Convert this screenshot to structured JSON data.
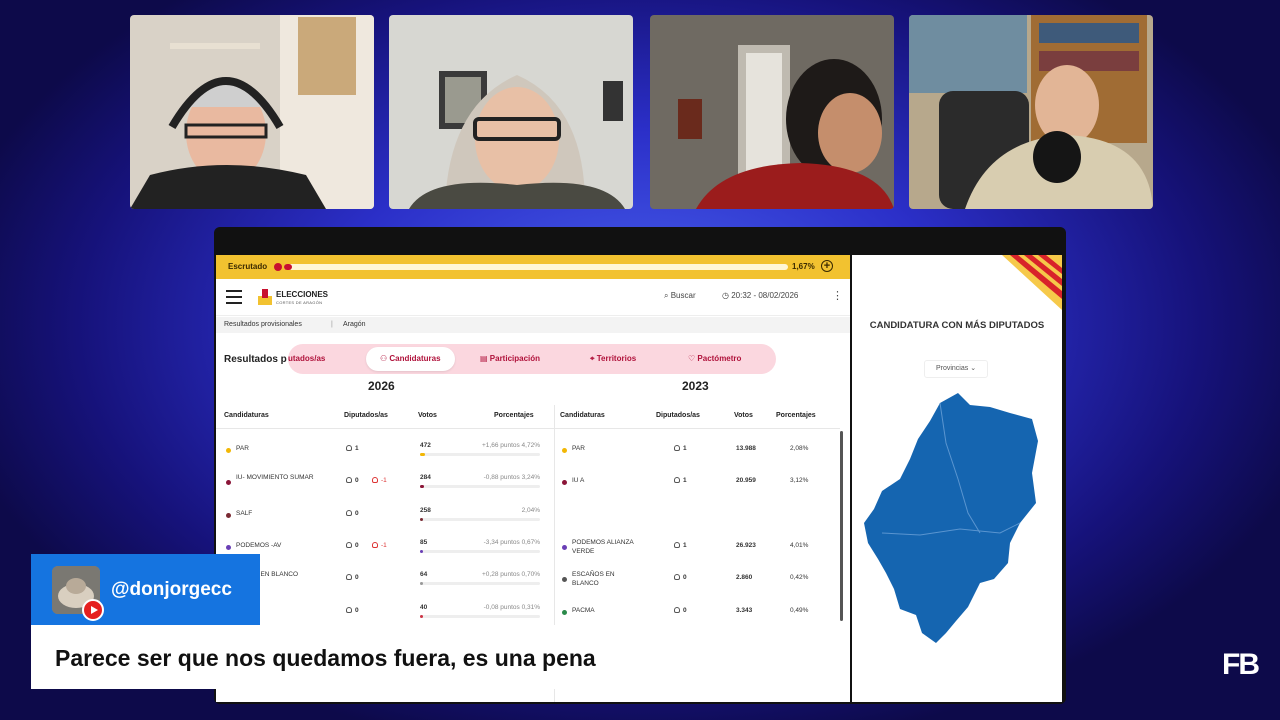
{
  "app": {
    "escrutado_label": "Escrutado",
    "escrutado_pct": "1,67%",
    "escrutado_fraction": 0.0167,
    "logo_title": "ELECCIONES",
    "logo_subtitle": "CORTES DE ARAGÓN",
    "search_label": "Buscar",
    "datetime": "20:32 - 08/02/2026",
    "breadcrumb": [
      "Resultados provisionales",
      "Aragón"
    ],
    "section_title": "Resultados p",
    "tabs": [
      "utados/as",
      "Candidaturas",
      "Participación",
      "Territorios",
      "Pactómetro"
    ],
    "years": [
      "2026",
      "2023"
    ],
    "columns": [
      "Candidaturas",
      "Diputados/as",
      "Votos",
      "Porcentajes"
    ],
    "rows_2026": [
      {
        "name": "PAR",
        "seats": "1",
        "delta": "",
        "votes": "472",
        "change": "+1,66 puntos 4,72%",
        "color": "#f2b705",
        "fill": 0.04
      },
      {
        "name": "IU- MOVIMIENTO SUMAR",
        "seats": "0",
        "delta": "-1",
        "votes": "284",
        "change": "-0,88 puntos 3,24%",
        "color": "#8b1538",
        "fill": 0.03
      },
      {
        "name": "SALF",
        "seats": "0",
        "delta": "",
        "votes": "258",
        "change": "2,04%",
        "color": "#7a2a33",
        "fill": 0.025
      },
      {
        "name": "PODEMOS -AV",
        "seats": "0",
        "delta": "-1",
        "votes": "85",
        "change": "-3,34 puntos 0,67%",
        "color": "#6a3fb5",
        "fill": 0.01
      },
      {
        "name": "VOTOS EN BLANCO",
        "seats": "0",
        "delta": "",
        "votes": "64",
        "change": "+0,28 puntos 0,70%",
        "color": "#999999",
        "fill": 0.008
      },
      {
        "name": "",
        "seats": "0",
        "delta": "",
        "votes": "40",
        "change": "-0,08 puntos 0,31%",
        "color": "#cc3344",
        "fill": 0.005
      }
    ],
    "rows_2023": [
      {
        "name": "PAR",
        "seats": "1",
        "votes": "13.988",
        "pct": "2,08%",
        "color": "#f2b705"
      },
      {
        "name": "IU A",
        "seats": "1",
        "votes": "20.959",
        "pct": "3,12%",
        "color": "#8b1538"
      },
      {
        "name": "PODEMOS ALIANZA VERDE",
        "seats": "1",
        "votes": "26.923",
        "pct": "4,01%",
        "color": "#6a3fb5"
      },
      {
        "name": "ESCAÑOS EN BLANCO",
        "seats": "0",
        "votes": "2.860",
        "pct": "0,42%",
        "color": "#555555"
      },
      {
        "name": "PACMA",
        "seats": "0",
        "votes": "3.343",
        "pct": "0,49%",
        "color": "#2a8a4a"
      }
    ],
    "side_title": "CANDIDATURA CON MÁS DIPUTADOS",
    "side_select": "Provincias"
  },
  "chat": {
    "username": "@donjorgecc",
    "message": "Parece ser que nos quedamos fuera, es una pena"
  },
  "brand": "FB",
  "colors": {
    "accent": "#c8102e",
    "topbar": "#f2c230",
    "map": "#1565b0",
    "chat_user_bg": "#1574e0"
  }
}
